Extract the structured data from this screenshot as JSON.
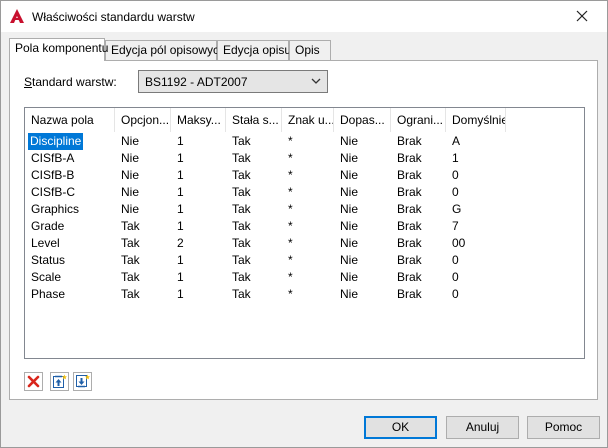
{
  "window": {
    "title": "Właściwości standardu warstw"
  },
  "tabs": [
    {
      "label": "Pola komponentu"
    },
    {
      "label": "Edycja pól opisowych"
    },
    {
      "label": "Edycja opisu"
    },
    {
      "label": "Opis"
    }
  ],
  "standard": {
    "label_u": "S",
    "label_rest": "tandard warstw:",
    "selected": "BS1192 - ADT2007"
  },
  "columns": [
    "Nazwa pola",
    "Opcjon...",
    "Maksy...",
    "Stała s...",
    "Znak u...",
    "Dopas...",
    "Ograni...",
    "Domyślnie"
  ],
  "rows": [
    [
      "Discipline",
      "Nie",
      "1",
      "Tak",
      "*",
      "Nie",
      "Brak",
      "A"
    ],
    [
      "CISfB-A",
      "Nie",
      "1",
      "Tak",
      "*",
      "Nie",
      "Brak",
      "1"
    ],
    [
      "CISfB-B",
      "Nie",
      "1",
      "Tak",
      "*",
      "Nie",
      "Brak",
      "0"
    ],
    [
      "CISfB-C",
      "Nie",
      "1",
      "Tak",
      "*",
      "Nie",
      "Brak",
      "0"
    ],
    [
      "Graphics",
      "Nie",
      "1",
      "Tak",
      "*",
      "Nie",
      "Brak",
      "G"
    ],
    [
      "Grade",
      "Tak",
      "1",
      "Tak",
      "*",
      "Nie",
      "Brak",
      "7"
    ],
    [
      "Level",
      "Tak",
      "2",
      "Tak",
      "*",
      "Nie",
      "Brak",
      "00"
    ],
    [
      "Status",
      "Tak",
      "1",
      "Tak",
      "*",
      "Nie",
      "Brak",
      "0"
    ],
    [
      "Scale",
      "Tak",
      "1",
      "Tak",
      "*",
      "Nie",
      "Brak",
      "0"
    ],
    [
      "Phase",
      "Tak",
      "1",
      "Tak",
      "*",
      "Nie",
      "Brak",
      "0"
    ]
  ],
  "selected_row": 0,
  "toolbar": {
    "icons": [
      "delete-icon",
      "move-up-icon",
      "move-down-icon"
    ]
  },
  "buttons": {
    "ok": "OK",
    "cancel": "Anuluj",
    "help": "Pomoc"
  },
  "colors": {
    "selection": "#0078d7",
    "delete_red": "#d9261c",
    "app_red": "#c8102e"
  }
}
